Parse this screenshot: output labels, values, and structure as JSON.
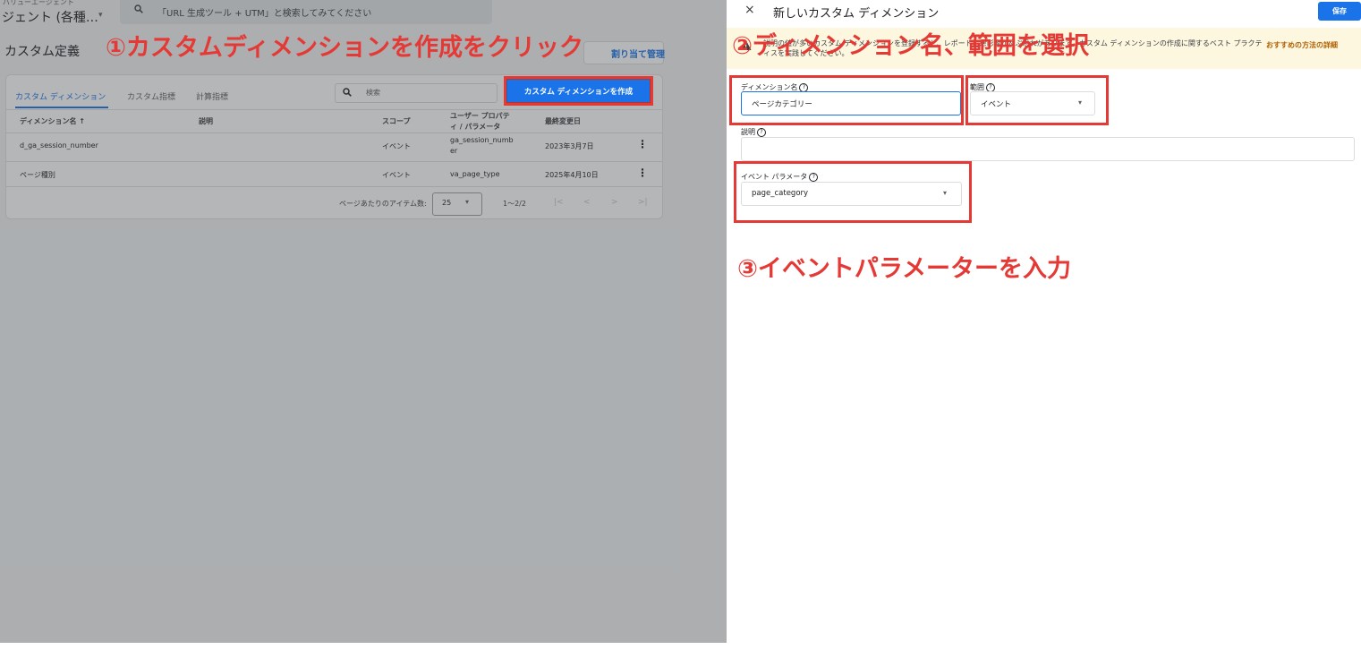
{
  "left_page": {
    "account_small": "バリューエージェント",
    "account_main": "ジェント (各種…",
    "search_placeholder": "「URL 生成ツール + UTM」と検索してみてください",
    "page_title": "カスタム定義",
    "assign_button": "割り当て管理",
    "tabs": [
      {
        "label": "カスタム ディメンション",
        "active": true
      },
      {
        "label": "カスタム指標",
        "active": false
      },
      {
        "label": "計算指標",
        "active": false
      }
    ],
    "card_search_placeholder": "検索",
    "create_button": "カスタム ディメンションを作成",
    "columns": {
      "name": "ディメンション名 ↑",
      "description": "説明",
      "scope": "スコープ",
      "user_property_1": "ユーザー プロパテ",
      "user_property_2": "ィ / パラメータ",
      "last_modified": "最終変更日"
    },
    "rows": [
      {
        "name": "d_ga_session_number",
        "scope": "イベント",
        "param_1": "ga_session_numb",
        "param_2": "er",
        "date": "2023年3月7日"
      },
      {
        "name": "ページ種別",
        "scope": "イベント",
        "param_1": "va_page_type",
        "param_2": "",
        "date": "2025年4月10日"
      }
    ],
    "pager": {
      "items_label": "ページあたりのアイテム数:",
      "per_page": "25",
      "range": "1～2/2",
      "first": "|<",
      "prev": "<",
      "next": ">",
      "last": ">|"
    }
  },
  "panel": {
    "close": "×",
    "title": "新しいカスタム ディメンション",
    "save": "保存",
    "banner_text": "説明の値が多いカスタム ディメンションを登録すると、レポートに悪影響が及ぶ恐れがあります。カスタム ディメンションの作成に関するベスト プラクティスを実践してください。",
    "banner_link": "おすすめの方法の詳細",
    "dimension_name_label": "ディメンション名",
    "dimension_name_value": "ページカテゴリー",
    "scope_label": "範囲",
    "scope_value": "イベント",
    "description_label": "説明",
    "event_param_label": "イベント パラメータ",
    "event_param_value": "page_category"
  },
  "annotations": {
    "step1": "①カスタムディメンションを作成をクリック",
    "step2": "②ディメンション名、範囲を選択",
    "step3": "③イベントパラメーターを入力"
  },
  "colors": {
    "accent": "#1a73e8",
    "annotation": "#e53935",
    "banner": "#fef7e0"
  }
}
